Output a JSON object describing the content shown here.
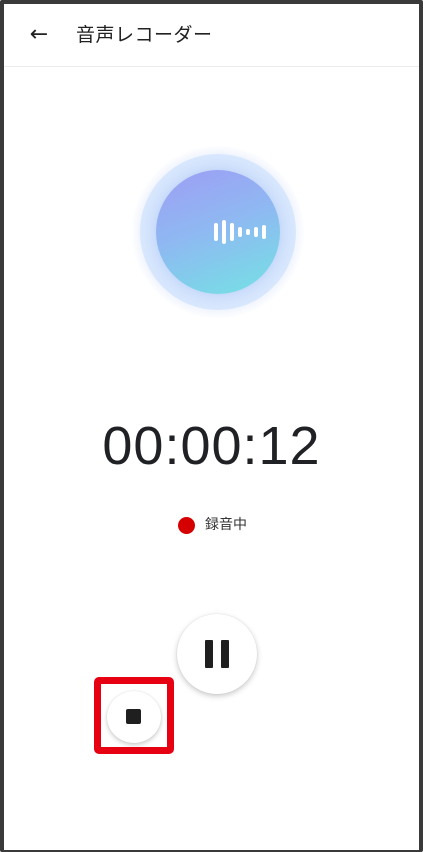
{
  "app_bar": {
    "back_icon": "arrow-left-icon",
    "back_glyph": "←",
    "title": "音声レコーダー"
  },
  "visualizer": {
    "icon": "audio-waveform-icon"
  },
  "recording": {
    "elapsed_time": "00:00:12",
    "status_label": "録音中",
    "status_color": "#d50000"
  },
  "controls": {
    "pause_icon": "pause-icon",
    "stop_icon": "stop-icon",
    "highlight_color": "#e60012"
  }
}
